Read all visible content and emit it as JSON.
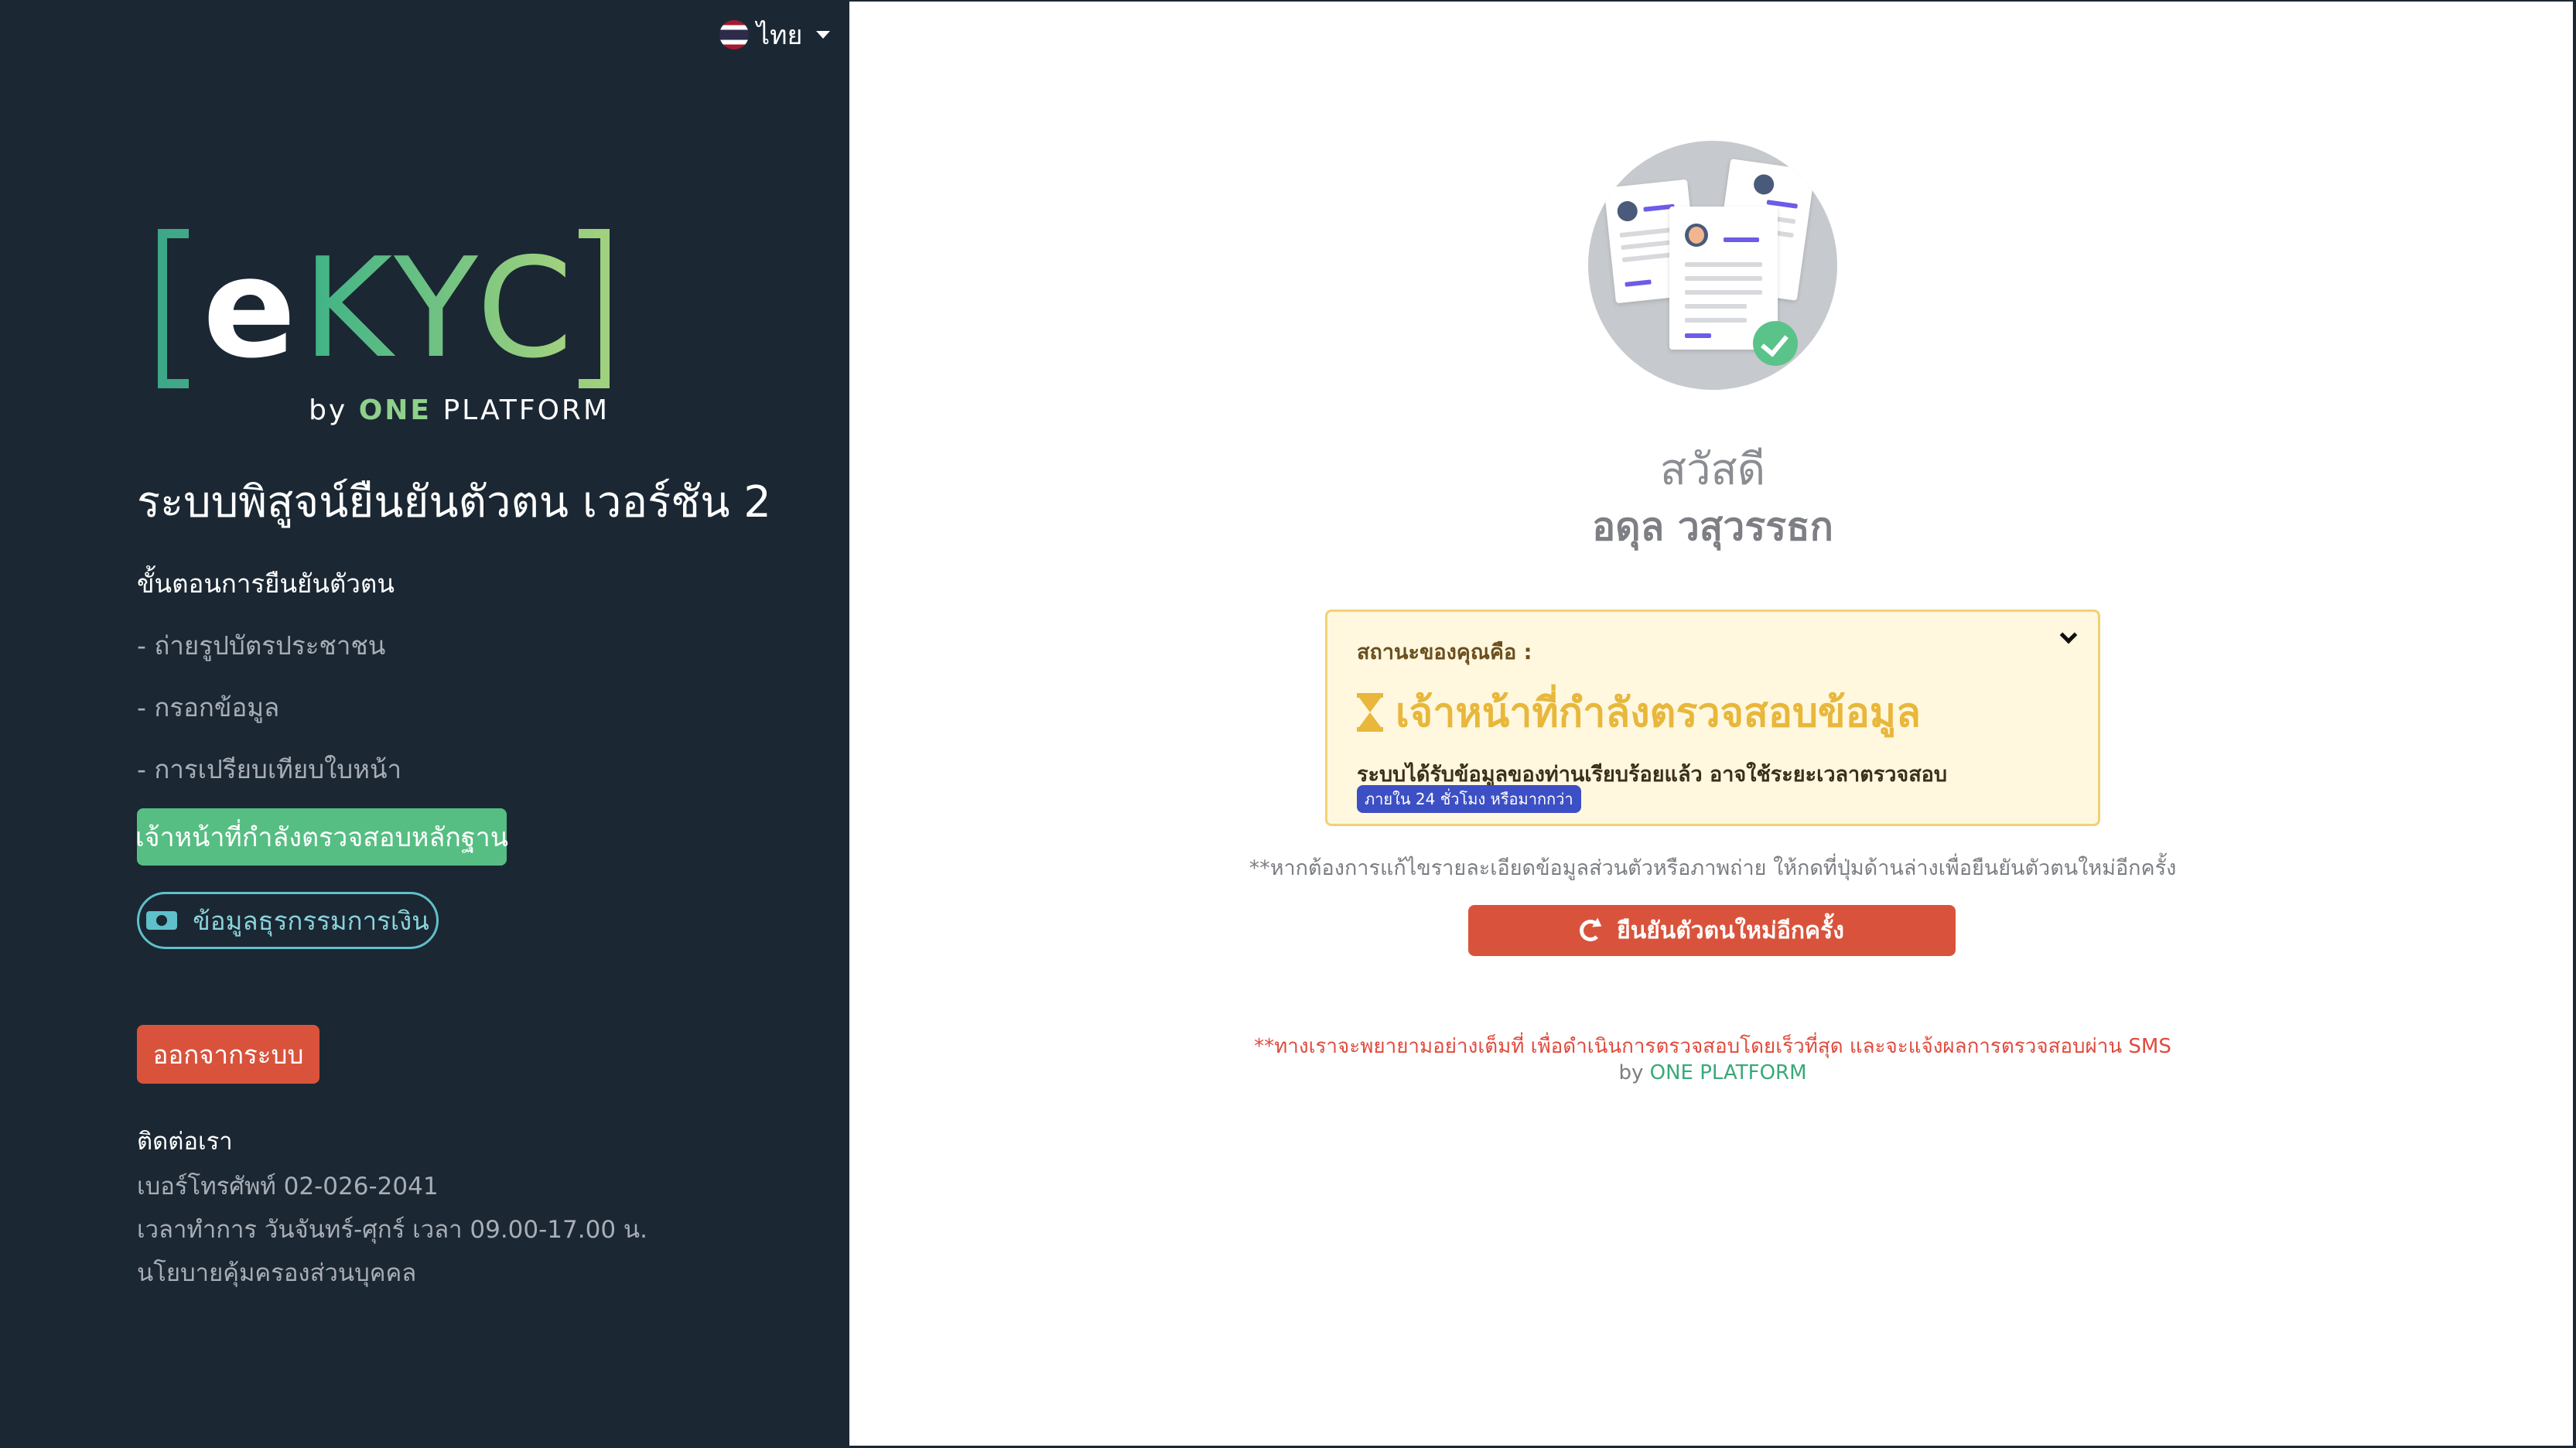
{
  "language": {
    "label": "ไทย"
  },
  "logo": {
    "text_e": "e",
    "text_kyc": "KYC",
    "by": "by",
    "one": "ONE",
    "platform": "PLATFORM"
  },
  "sidebar": {
    "system_title": "ระบบพิสูจน์ยืนยันตัวตน เวอร์ชัน 2",
    "steps_title": "ขั้นตอนการยืนยันตัวตน",
    "steps": [
      "- ถ่ายรูปบัตรประชาชน",
      "- กรอกข้อมูล",
      "- การเปรียบเทียบใบหน้า"
    ],
    "status_pill": "เจ้าหน้าที่กำลังตรวจสอบหลักฐาน",
    "finance_button": "ข้อมูลธุรกรรมการเงิน",
    "logout_button": "ออกจากระบบ",
    "contact": {
      "title": "ติดต่อเรา",
      "phone": "เบอร์โทรศัพท์ 02-026-2041",
      "hours": "เวลาทำการ วันจันทร์-ศุกร์ เวลา 09.00-17.00 น.",
      "privacy": "นโยบายคุ้มครองส่วนบุคคล"
    }
  },
  "main": {
    "greeting": "สวัสดี",
    "user_name": "อดุล วสุวรรธก",
    "status": {
      "label": "สถานะของคุณคือ :",
      "title": "เจ้าหน้าที่กำลังตรวจสอบข้อมูล",
      "description": "ระบบได้รับข้อมูลของท่านเรียบร้อยแล้ว อาจใช้ระยะเวลาตรวจสอบ",
      "badge": "ภายใน 24 ชั่วโมง หรือมากกว่า"
    },
    "note": "**หากต้องการแก้ไขรายละเอียดข้อมูลส่วนตัวหรือภาพถ่าย ให้กดที่ปุ่มด้านล่างเพื่อยืนยันตัวตนใหม่อีกครั้ง",
    "redo_button": "ยืนยันตัวตนใหม่อีกครั้ง",
    "footer_notice": "**ทางเราจะพยายามอย่างเต็มที่ เพื่อดำเนินการตรวจสอบโดยเร็วที่สุด และจะแจ้งผลการตรวจสอบผ่าน SMS",
    "footer_by": "by",
    "footer_brand": "ONE PLATFORM"
  },
  "colors": {
    "sidebar_bg": "#1b2733",
    "accent_green": "#56be83",
    "danger": "#d9533c",
    "warning_bg": "#fff8df",
    "warning_text": "#e8b73b",
    "badge": "#3d4fc4"
  },
  "icons": [
    "thailand-flag-icon",
    "chevron-down-icon",
    "cash-icon",
    "hourglass-icon",
    "refresh-icon",
    "check-icon"
  ]
}
